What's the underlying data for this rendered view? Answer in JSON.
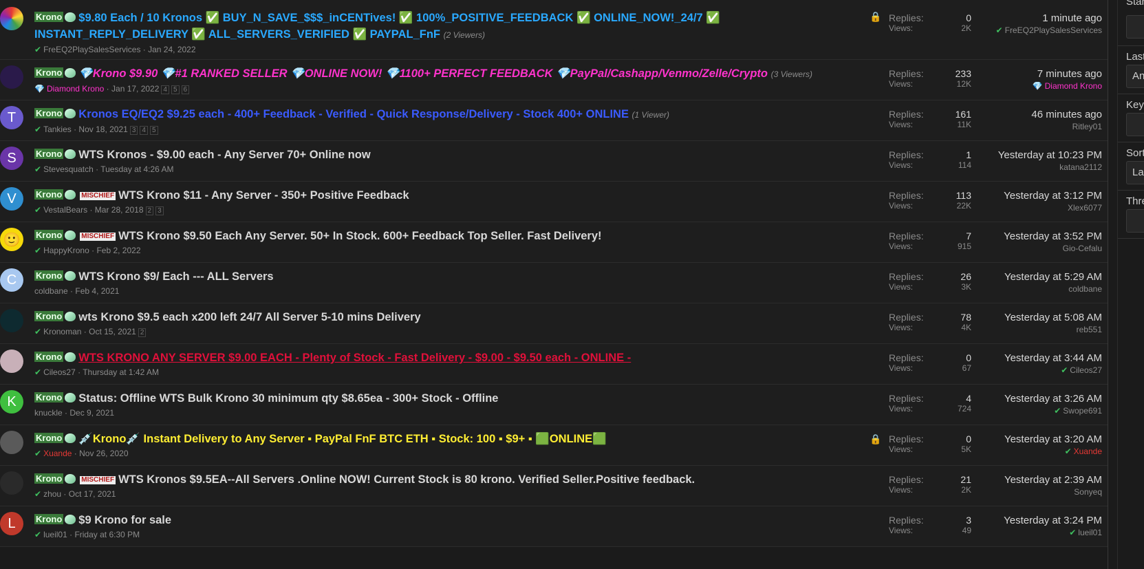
{
  "rows": [
    {
      "avatar": {
        "letter": "",
        "bg": "conic-gradient(#e53935,#fdd835,#43a047,#1e88e5,#8e24aa,#e53935)"
      },
      "prefix": "Krono",
      "mischief": false,
      "title": "$9.80 Each / 10 Kronos ✅ BUY_N_SAVE_$$$_inCENTives! ✅ 100%_POSITIVE_FEEDBACK ✅ ONLINE_NOW!_24/7 ✅ INSTANT_REPLY_DELIVERY ✅ ALL_SERVERS_VERIFIED ✅ PAYPAL_FnF",
      "title_color": "#2aa9ff",
      "italic": false,
      "viewers": "(2 Viewers)",
      "author": "FreEQ2PlaySalesServices",
      "author_verified": true,
      "author_color": "#8c8c8c",
      "date": "Jan 24, 2022",
      "pages": [],
      "locked": true,
      "replies": "0",
      "views": "2K",
      "last_time": "1 minute ago",
      "last_user": "FreEQ2PlaySalesServices",
      "last_verified": true,
      "last_user_color": "#8c8c8c"
    },
    {
      "avatar": {
        "letter": "",
        "bg": "#2a1a4a"
      },
      "prefix": "Krono",
      "mischief": false,
      "title": "💎Krono $9.90 💎#1 RANKED SELLER 💎ONLINE NOW! 💎1100+ PERFECT FEEDBACK 💎PayPal/Cashapp/Venmo/Zelle/Crypto",
      "title_color": "#ff33cc",
      "italic": true,
      "viewers": "(3 Viewers)",
      "author": "Diamond Krono",
      "author_verified": false,
      "author_color": "#ff33cc",
      "date": "Jan 17, 2022",
      "pages": [
        "4",
        "5",
        "6"
      ],
      "locked": false,
      "replies": "233",
      "views": "12K",
      "last_time": "7 minutes ago",
      "last_user": "Diamond Krono",
      "last_verified": false,
      "last_user_color": "#ff33cc"
    },
    {
      "avatar": {
        "letter": "T",
        "bg": "#6a5acd"
      },
      "prefix": "Krono",
      "mischief": false,
      "title": "Kronos EQ/EQ2 $9.25 each - 400+ Feedback - Verified - Quick Response/Delivery - Stock 400+ ONLINE",
      "title_color": "#3b5bff",
      "italic": false,
      "viewers": "(1 Viewer)",
      "author": "Tankies",
      "author_verified": true,
      "author_color": "#8c8c8c",
      "date": "Nov 18, 2021",
      "pages": [
        "3",
        "4",
        "5"
      ],
      "locked": false,
      "replies": "161",
      "views": "11K",
      "last_time": "46 minutes ago",
      "last_user": "Ritley01",
      "last_verified": false,
      "last_user_color": "#8c8c8c"
    },
    {
      "avatar": {
        "letter": "S",
        "bg": "#6a35a8"
      },
      "prefix": "Krono",
      "mischief": false,
      "title": "WTS Kronos - $9.00 each - Any Server 70+ Online now",
      "title_color": "#d8d8d8",
      "italic": false,
      "viewers": "",
      "author": "Stevesquatch",
      "author_verified": true,
      "author_color": "#8c8c8c",
      "date": "Tuesday at 4:26 AM",
      "pages": [],
      "locked": false,
      "replies": "1",
      "views": "114",
      "last_time": "Yesterday at 10:23 PM",
      "last_user": "katana2112",
      "last_verified": false,
      "last_user_color": "#8c8c8c"
    },
    {
      "avatar": {
        "letter": "V",
        "bg": "#2f8fd0"
      },
      "prefix": "Krono",
      "mischief": true,
      "title": "WTS Krono $11 - Any Server - 350+ Positive Feedback",
      "title_color": "#d8d8d8",
      "italic": false,
      "viewers": "",
      "author": "VestalBears",
      "author_verified": true,
      "author_color": "#8c8c8c",
      "date": "Mar 28, 2018",
      "pages": [
        "2",
        "3"
      ],
      "locked": false,
      "replies": "113",
      "views": "22K",
      "last_time": "Yesterday at 3:12 PM",
      "last_user": "Xlex6077",
      "last_verified": false,
      "last_user_color": "#8c8c8c"
    },
    {
      "avatar": {
        "letter": "🙂",
        "bg": "#f5d90a"
      },
      "prefix": "Krono",
      "mischief": true,
      "title": "WTS Krono $9.50 Each Any Server. 50+ In Stock. 600+ Feedback Top Seller. Fast Delivery!",
      "title_color": "#d8d8d8",
      "italic": false,
      "viewers": "",
      "author": "HappyKrono",
      "author_verified": true,
      "author_color": "#8c8c8c",
      "date": "Feb 2, 2022",
      "pages": [],
      "locked": false,
      "replies": "7",
      "views": "915",
      "last_time": "Yesterday at 3:52 PM",
      "last_user": "Gio-Cefalu",
      "last_verified": false,
      "last_user_color": "#8c8c8c"
    },
    {
      "avatar": {
        "letter": "C",
        "bg": "#a8c8f0"
      },
      "prefix": "Krono",
      "mischief": false,
      "title": "WTS Krono $9/ Each --- ALL Servers",
      "title_color": "#d8d8d8",
      "italic": false,
      "viewers": "",
      "author": "coldbane",
      "author_verified": false,
      "author_color": "#8c8c8c",
      "date": "Feb 4, 2021",
      "pages": [],
      "locked": false,
      "replies": "26",
      "views": "3K",
      "last_time": "Yesterday at 5:29 AM",
      "last_user": "coldbane",
      "last_verified": false,
      "last_user_color": "#8c8c8c"
    },
    {
      "avatar": {
        "letter": "",
        "bg": "#0e2a30"
      },
      "prefix": "Krono",
      "mischief": false,
      "title": "wts Krono $9.5 each x200 left 24/7 All Server 5-10 mins Delivery",
      "title_color": "#d8d8d8",
      "italic": false,
      "viewers": "",
      "author": "Kronoman",
      "author_verified": true,
      "author_color": "#8c8c8c",
      "date": "Oct 15, 2021",
      "pages": [
        "2"
      ],
      "locked": false,
      "replies": "78",
      "views": "4K",
      "last_time": "Yesterday at 5:08 AM",
      "last_user": "reb551",
      "last_verified": false,
      "last_user_color": "#8c8c8c"
    },
    {
      "avatar": {
        "letter": "",
        "bg": "#c8b0b8"
      },
      "prefix": "Krono",
      "mischief": false,
      "title": "WTS KRONO ANY SERVER $9.00 EACH - Plenty of Stock - Fast Delivery - $9.00 - $9.50 each - ONLINE -",
      "title_color": "#e0103a",
      "italic": false,
      "viewers": "",
      "author": "Cileos27",
      "author_verified": true,
      "author_color": "#8c8c8c",
      "date": "Thursday at 1:42 AM",
      "pages": [],
      "locked": false,
      "replies": "0",
      "views": "67",
      "last_time": "Yesterday at 3:44 AM",
      "last_user": "Cileos27",
      "last_verified": true,
      "last_user_color": "#8c8c8c"
    },
    {
      "avatar": {
        "letter": "K",
        "bg": "#3fbf3f"
      },
      "prefix": "Krono",
      "mischief": false,
      "title": "Status: Offline WTS Bulk Krono 30 minimum qty $8.65ea - 300+ Stock - Offline",
      "title_color": "#d8d8d8",
      "italic": false,
      "viewers": "",
      "author": "knuckle",
      "author_verified": false,
      "author_color": "#8c8c8c",
      "date": "Dec 9, 2021",
      "pages": [],
      "locked": false,
      "replies": "4",
      "views": "724",
      "last_time": "Yesterday at 3:26 AM",
      "last_user": "Swope691",
      "last_verified": true,
      "last_user_color": "#8c8c8c"
    },
    {
      "avatar": {
        "letter": "",
        "bg": "#5a5a5a"
      },
      "prefix": "Krono",
      "mischief": false,
      "title": "💉Krono💉 Instant Delivery to Any Server ▪ PayPal FnF BTC ETH ▪ Stock: 100 ▪ $9+ ▪ 🟩ONLINE🟩",
      "title_color": "#ffee33",
      "italic": false,
      "viewers": "",
      "author": "Xuande",
      "author_verified": true,
      "author_color": "#e53935",
      "date": "Nov 26, 2020",
      "pages": [],
      "locked": true,
      "replies": "0",
      "views": "5K",
      "last_time": "Yesterday at 3:20 AM",
      "last_user": "Xuande",
      "last_verified": true,
      "last_user_color": "#e53935"
    },
    {
      "avatar": {
        "letter": "",
        "bg": "#2a2a2a"
      },
      "prefix": "Krono",
      "mischief": true,
      "title": "WTS Kronos $9.5EA--All Servers .Online NOW! Current Stock is 80 krono. Verified Seller.Positive feedback.",
      "title_color": "#d8d8d8",
      "italic": false,
      "viewers": "",
      "author": "zhou",
      "author_verified": true,
      "author_color": "#8c8c8c",
      "date": "Oct 17, 2021",
      "pages": [],
      "locked": false,
      "replies": "21",
      "views": "2K",
      "last_time": "Yesterday at 2:39 AM",
      "last_user": "Sonyeq",
      "last_verified": false,
      "last_user_color": "#8c8c8c"
    },
    {
      "avatar": {
        "letter": "L",
        "bg": "#c0392b"
      },
      "prefix": "Krono",
      "mischief": false,
      "title": "$9 Krono for sale",
      "title_color": "#d8d8d8",
      "italic": false,
      "viewers": "",
      "author": "lueil01",
      "author_verified": true,
      "author_color": "#8c8c8c",
      "date": "Friday at 6:30 PM",
      "pages": [],
      "locked": false,
      "replies": "3",
      "views": "49",
      "last_time": "Yesterday at 3:24 PM",
      "last_user": "lueil01",
      "last_verified": true,
      "last_user_color": "#8c8c8c"
    }
  ],
  "labels": {
    "replies": "Replies:",
    "views": "Views:",
    "mischief": "MISCHIEF"
  },
  "sidebar": {
    "items": [
      {
        "label": "Star",
        "box": ""
      },
      {
        "label": "Last",
        "box": "An"
      },
      {
        "label": "Keyw",
        "box": ""
      },
      {
        "label": "Sort",
        "box": "Las"
      },
      {
        "label": "Thre",
        "box": ""
      }
    ]
  },
  "colors": {
    "verified": "#3fbf5f",
    "background": "#1b1b1b",
    "row": "#1e1e1e"
  }
}
